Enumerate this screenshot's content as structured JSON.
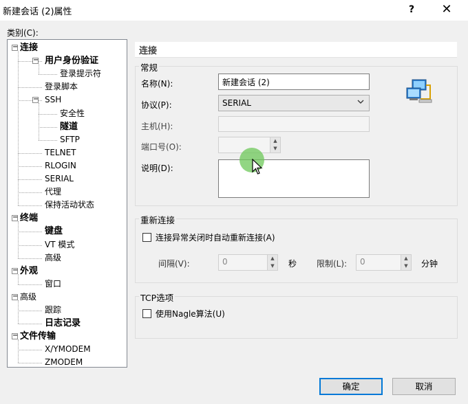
{
  "window": {
    "title": "新建会话 (2)属性",
    "help": "?",
    "close": "✕"
  },
  "category_label": "类别(C):",
  "tree": [
    {
      "label": "连接",
      "level": 0,
      "bold": true,
      "expander": "−"
    },
    {
      "label": "用户身份验证",
      "level": 1,
      "bold": true,
      "expander": "−"
    },
    {
      "label": "登录提示符",
      "level": 2,
      "bold": false,
      "expander": null
    },
    {
      "label": "登录脚本",
      "level": 1,
      "bold": false,
      "expander": null
    },
    {
      "label": "SSH",
      "level": 1,
      "bold": false,
      "expander": "−"
    },
    {
      "label": "安全性",
      "level": 2,
      "bold": false,
      "expander": null
    },
    {
      "label": "隧道",
      "level": 2,
      "bold": true,
      "expander": null
    },
    {
      "label": "SFTP",
      "level": 2,
      "bold": false,
      "expander": null
    },
    {
      "label": "TELNET",
      "level": 1,
      "bold": false,
      "expander": null
    },
    {
      "label": "RLOGIN",
      "level": 1,
      "bold": false,
      "expander": null
    },
    {
      "label": "SERIAL",
      "level": 1,
      "bold": false,
      "expander": null
    },
    {
      "label": "代理",
      "level": 1,
      "bold": false,
      "expander": null
    },
    {
      "label": "保持活动状态",
      "level": 1,
      "bold": false,
      "expander": null
    },
    {
      "label": "终端",
      "level": 0,
      "bold": true,
      "expander": "−"
    },
    {
      "label": "键盘",
      "level": 1,
      "bold": true,
      "expander": null
    },
    {
      "label": "VT 模式",
      "level": 1,
      "bold": false,
      "expander": null
    },
    {
      "label": "高级",
      "level": 1,
      "bold": false,
      "expander": null
    },
    {
      "label": "外观",
      "level": 0,
      "bold": true,
      "expander": "−"
    },
    {
      "label": "窗口",
      "level": 1,
      "bold": false,
      "expander": null
    },
    {
      "label": "高级",
      "level": 0,
      "bold": false,
      "expander": "−"
    },
    {
      "label": "跟踪",
      "level": 1,
      "bold": false,
      "expander": null
    },
    {
      "label": "日志记录",
      "level": 1,
      "bold": true,
      "expander": null
    },
    {
      "label": "文件传输",
      "level": 0,
      "bold": true,
      "expander": "−"
    },
    {
      "label": "X/YMODEM",
      "level": 1,
      "bold": false,
      "expander": null
    },
    {
      "label": "ZMODEM",
      "level": 1,
      "bold": false,
      "expander": null
    }
  ],
  "panel": {
    "title": "连接",
    "general": {
      "group_label": "常规",
      "name_label": "名称(N):",
      "name_value": "新建会话 (2)",
      "protocol_label": "协议(P):",
      "protocol_value": "SERIAL",
      "host_label": "主机(H):",
      "host_value": "",
      "port_label": "端口号(O):",
      "port_value": "",
      "desc_label": "说明(D):",
      "desc_value": ""
    },
    "reconnect": {
      "group_label": "重新连接",
      "checkbox_label": "连接异常关闭时自动重新连接(A)",
      "checked": false,
      "interval_label": "间隔(V):",
      "interval_value": "0",
      "interval_unit": "秒",
      "limit_label": "限制(L):",
      "limit_value": "0",
      "limit_unit": "分钟"
    },
    "tcp": {
      "group_label": "TCP选项",
      "nagle_label": "使用Nagle算法(U)",
      "checked": false
    }
  },
  "buttons": {
    "ok": "确定",
    "cancel": "取消"
  },
  "icons": {
    "session": "network-computers-icon",
    "cursor": "mouse-pointer-icon"
  },
  "colors": {
    "accent": "#0078d7",
    "cursor_highlight": "#6ec85a"
  }
}
